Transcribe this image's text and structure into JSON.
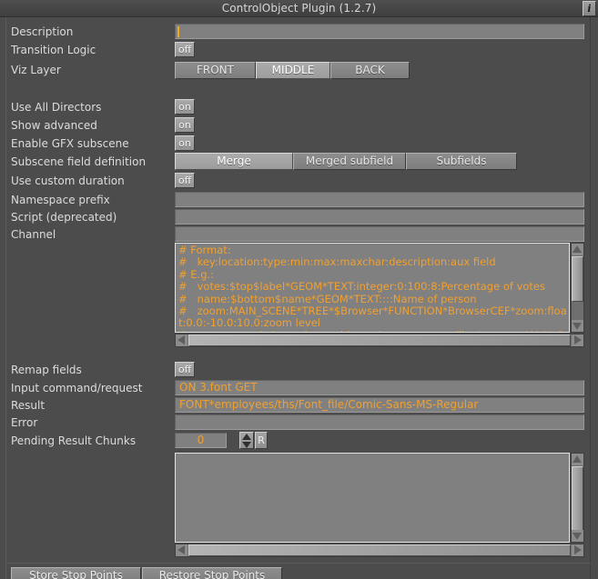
{
  "window": {
    "title": "ControlObject Plugin (1.2.7)",
    "info_button": "i"
  },
  "rows": {
    "description": {
      "label": "Description",
      "value": ""
    },
    "transition_logic": {
      "label": "Transition Logic",
      "value": "off"
    },
    "viz_layer": {
      "label": "Viz Layer",
      "options": [
        "FRONT",
        "MIDDLE",
        "BACK"
      ],
      "selected": "MIDDLE"
    },
    "use_all_directors": {
      "label": "Use All Directors",
      "value": "on"
    },
    "show_advanced": {
      "label": "Show advanced",
      "value": "on"
    },
    "enable_gfx_subscene": {
      "label": "Enable GFX subscene",
      "value": "on"
    },
    "subscene_field_definition": {
      "label": "Subscene field definition",
      "options": [
        "Merge",
        "Merged subfield",
        "Subfields"
      ],
      "selected": "Merge"
    },
    "use_custom_duration": {
      "label": "Use custom duration",
      "value": "off"
    },
    "namespace_prefix": {
      "label": "Namespace prefix",
      "value": ""
    },
    "script_deprecated": {
      "label": "Script (deprecated)",
      "value": ""
    },
    "channel": {
      "label": "Channel",
      "value": ""
    },
    "remap_fields": {
      "label": "Remap fields",
      "value": "off"
    },
    "input_command": {
      "label": "Input command/request",
      "value": "ON 3.font GET"
    },
    "result": {
      "label": "Result",
      "value": "FONT*employees/ths/Font_file/Comic-Sans-MS-Regular"
    },
    "error": {
      "label": "Error",
      "value": ""
    },
    "pending_result_chunks": {
      "label": "Pending Result Chunks",
      "value": "0",
      "reset_button": "R"
    }
  },
  "channel_editor": {
    "text": "# Format:\n#   key:location:type:min:max:maxchar:description:aux field\n# E.g.:\n#   votes:$top$label*GEOM*TEXT:integer:0:100:8:Percentage of votes\n#   name:$bottom$name*GEOM*TEXT::::Name of person\n#   zoom:MAIN_SCENE*TREE*$Browser*FUNCTION*BrowserCEF*zoom:float:0.0:-10.0:10.0:zoom level\n# or use control channels to address the parameter. like#   zoom:MAIN_SCENE*TREE*$Browser:float:0.0:-10.0:10.0:zoom level"
  },
  "result_editor": {
    "text": ""
  },
  "buttons": {
    "store_stop_points": "Store Stop Points",
    "restore_stop_points": "Restore Stop Points"
  },
  "colors": {
    "window_bg": "#4c4c4c",
    "field_bg": "#808080",
    "field_text": "#f0a030",
    "label_text": "#dcdcdc",
    "caret": "#f5a623"
  }
}
